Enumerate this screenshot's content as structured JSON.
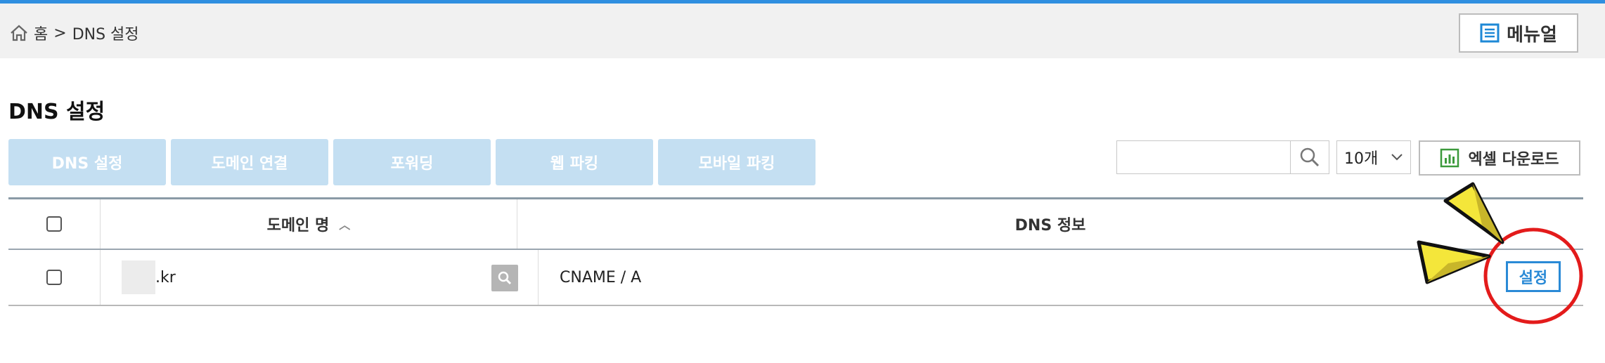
{
  "breadcrumb": {
    "home": "홈",
    "separator": ">",
    "current": "DNS 설정"
  },
  "manual_button": "메뉴얼",
  "page_title": "DNS 설정",
  "tabs": [
    {
      "label": "DNS 설정"
    },
    {
      "label": "도메인 연결"
    },
    {
      "label": "포워딩"
    },
    {
      "label": "웹 파킹"
    },
    {
      "label": "모바일 파킹"
    }
  ],
  "search": {
    "value": "",
    "placeholder": ""
  },
  "per_page": "10개",
  "excel_button": "엑셀 다운로드",
  "table": {
    "headers": {
      "domain": "도메인 명",
      "dns": "DNS 정보"
    },
    "rows": [
      {
        "domain_suffix": ".kr",
        "dns_info": "CNAME / A",
        "action": "설정"
      }
    ]
  },
  "colors": {
    "accent": "#2f8fe0",
    "tab_bg": "#c4dff2",
    "annotation_red": "#e31b1b",
    "annotation_yellow": "#f4e63a"
  },
  "icons": [
    "home-icon",
    "document-list-icon",
    "search-icon",
    "excel-chart-icon",
    "magnifier-icon"
  ]
}
